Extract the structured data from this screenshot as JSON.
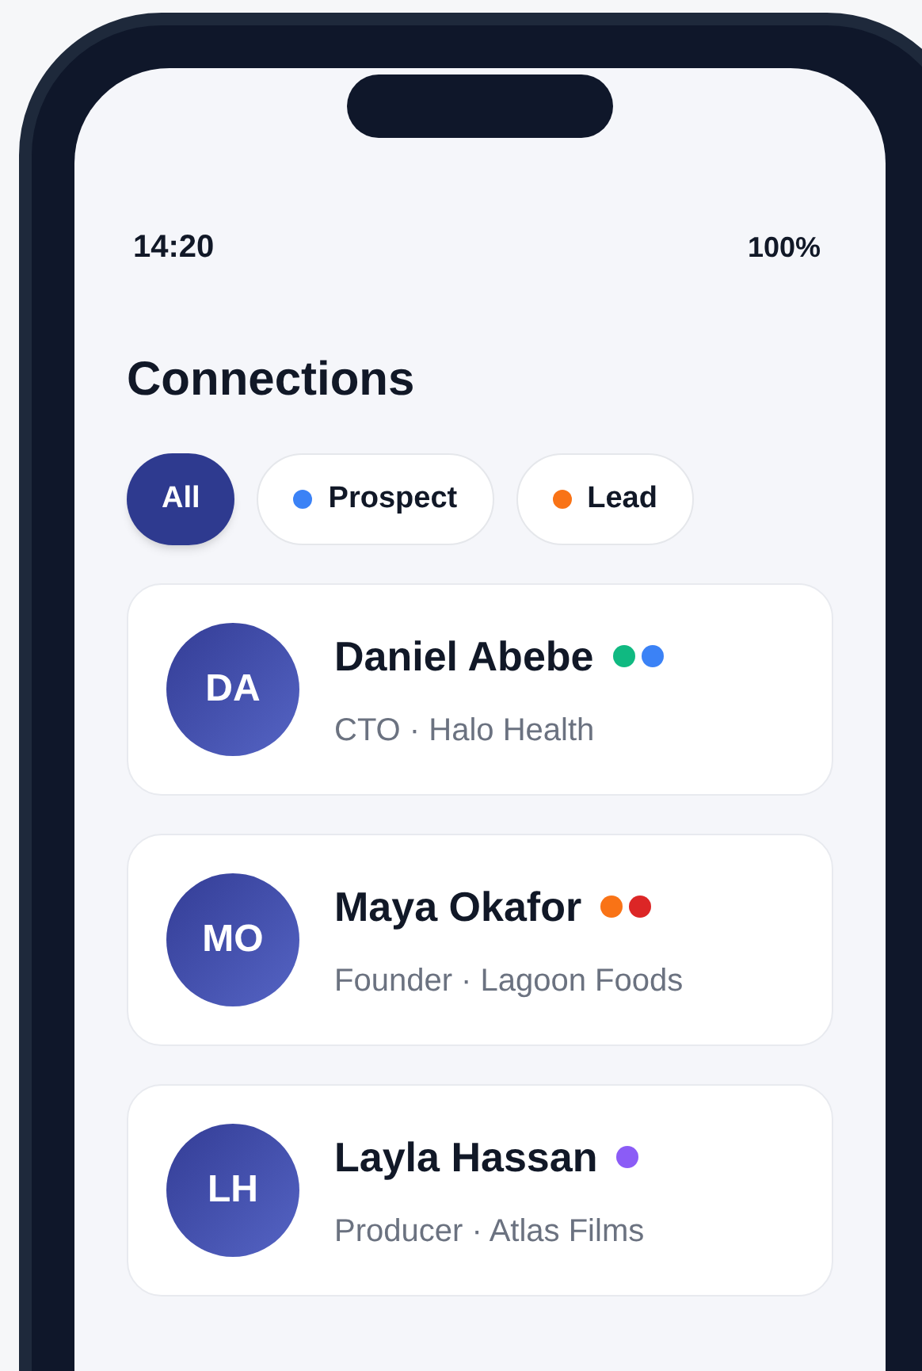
{
  "status_bar": {
    "time": "14:20",
    "battery": "100%"
  },
  "title": "Connections",
  "filters": [
    {
      "label": "All",
      "selected": true
    },
    {
      "label": "Prospect",
      "selected": false,
      "color": "#3b82f6"
    },
    {
      "label": "Lead",
      "selected": false,
      "color": "#f97316"
    }
  ],
  "contacts": [
    {
      "initials": "DA",
      "name": "Daniel Abebe",
      "subtitle": "CTO · Halo Health",
      "tags": [
        {
          "color": "#10b981"
        },
        {
          "color": "#3b82f6"
        }
      ]
    },
    {
      "initials": "MO",
      "name": "Maya Okafor",
      "subtitle": "Founder · Lagoon Foods",
      "tags": [
        {
          "color": "#f97316"
        },
        {
          "color": "#dc2626"
        }
      ]
    },
    {
      "initials": "LH",
      "name": "Layla Hassan",
      "subtitle": "Producer · Atlas Films",
      "tags": [
        {
          "color": "#8b5cf6"
        }
      ]
    }
  ]
}
